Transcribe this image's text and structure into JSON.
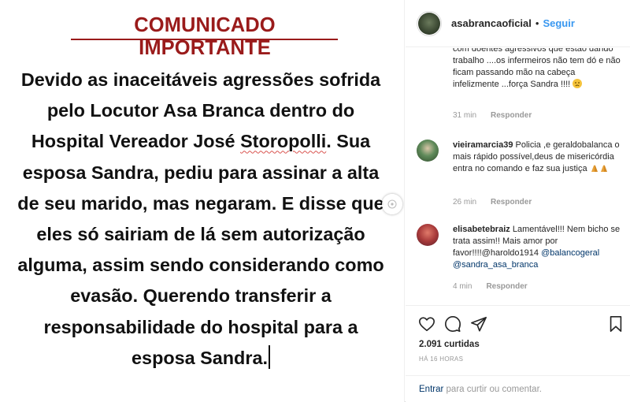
{
  "post": {
    "title": "COMUNICADO IMPORTANTE",
    "lines": [
      "Devido as inaceitáveis agressões sofrida",
      "pelo Locutor Asa Branca dentro do",
      "Hospital  Vereador José",
      "Storopolli",
      ". Sua",
      "esposa Sandra, pediu para assinar a alta",
      "de seu marido, mas negaram. E disse que",
      "eles só sairiam de lá sem autorização",
      "alguma, assim sendo considerando como",
      "evasão. Querendo transferir a",
      "responsabilidade do hospital para a",
      "esposa Sandra."
    ]
  },
  "header": {
    "username": "asabrancaoficial",
    "separator": "•",
    "follow_label": "Seguir"
  },
  "comments": [
    {
      "username": "",
      "text": "com doentes agressivos que estão dando trabalho ....os infermeiros não tem dó e não ficam passando mão na cabeça infelizmente ...força Sandra !!!!",
      "emoji": "sad-face",
      "time": "31 min",
      "reply_label": "Responder"
    },
    {
      "username": "vieiramarcia39",
      "text": "Policia ,e geraldobalanca o mais rápido possível,deus de misericórdia entra no comando e faz sua justiça",
      "emoji": "praying-hands",
      "time": "26 min",
      "reply_label": "Responder"
    },
    {
      "username": "elisabetebraiz",
      "text": "Lamentável!!! Nem bicho se trata assim!! Mais amor por favor!!!!@haroldo1914",
      "mention_1": "@balancogeral",
      "mention_2": "@sandra_asa_branca",
      "time": "4 min",
      "reply_label": "Responder"
    }
  ],
  "actions": {
    "likes": "2.091 curtidas",
    "time_ago": "HÁ 16 HORAS",
    "add_comment_link": "Entrar",
    "add_comment_text": " para curtir ou comentar."
  },
  "colors": {
    "title": "#9a1b1b",
    "follow": "#3897f0",
    "link": "#003569",
    "muted": "#999999"
  }
}
